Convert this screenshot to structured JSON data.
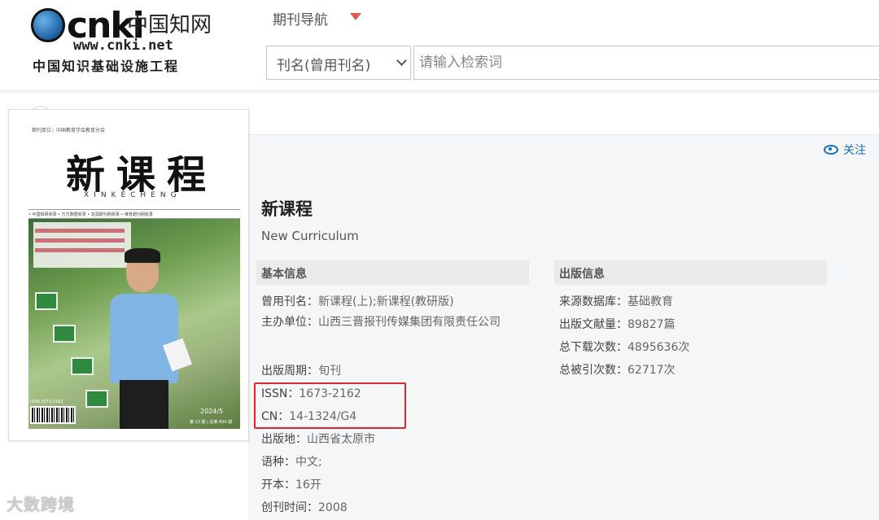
{
  "logo": {
    "brand": "cnki",
    "cn_name": "中国知网",
    "url": "www.cnki.net",
    "slogan": "中国知识基础设施工程"
  },
  "header": {
    "nav_label": "期刊导航",
    "search": {
      "field_selected": "刊名(曾用刊名)",
      "placeholder": "请输入检索词"
    }
  },
  "follow_label": "关注",
  "cover": {
    "top_text": "期刊单位：中国教育学会教育分会",
    "title": "新课程",
    "pinyin": "XINKECHENG",
    "bar_text": "• 中国知网收录   • 万方数据收录   • 龙源期刊网收录   • 维普期刊网收录",
    "issn": "ISSN 1673-2162",
    "date": "2024/5",
    "issue": "第 13 期 | 总第 600 期"
  },
  "journal": {
    "title": "新课程",
    "title_en": "New Curriculum"
  },
  "basic_info": {
    "heading": "基本信息",
    "former_names": {
      "label": "曾用刊名：",
      "value": "新课程(上);新课程(教研版)"
    },
    "sponsor": {
      "label": "主办单位：",
      "value": "山西三晋报刊传媒集团有限责任公司"
    },
    "frequency": {
      "label": "出版周期：",
      "value": "旬刊"
    },
    "issn": {
      "label": "ISSN：",
      "value": "1673-2162"
    },
    "cn": {
      "label": "CN：",
      "value": "14-1324/G4"
    },
    "location": {
      "label": "出版地：",
      "value": "山西省太原市"
    },
    "language": {
      "label": "语种：",
      "value": "中文;"
    },
    "format": {
      "label": "开本：",
      "value": "16开"
    },
    "founded": {
      "label": "创刊时间：",
      "value": "2008"
    }
  },
  "pub_info": {
    "heading": "出版信息",
    "database": {
      "label": "来源数据库：",
      "value": "基础教育"
    },
    "articles": {
      "label": "出版文献量：",
      "value": "89827篇"
    },
    "downloads": {
      "label": "总下载次数：",
      "value": "4895636次"
    },
    "citations": {
      "label": "总被引次数：",
      "value": "62717次"
    }
  },
  "watermark": "大数跨境",
  "colors": {
    "highlight_border": "#e0262b",
    "accent_caret": "#e0584b",
    "link_blue": "#1a6fb8"
  }
}
